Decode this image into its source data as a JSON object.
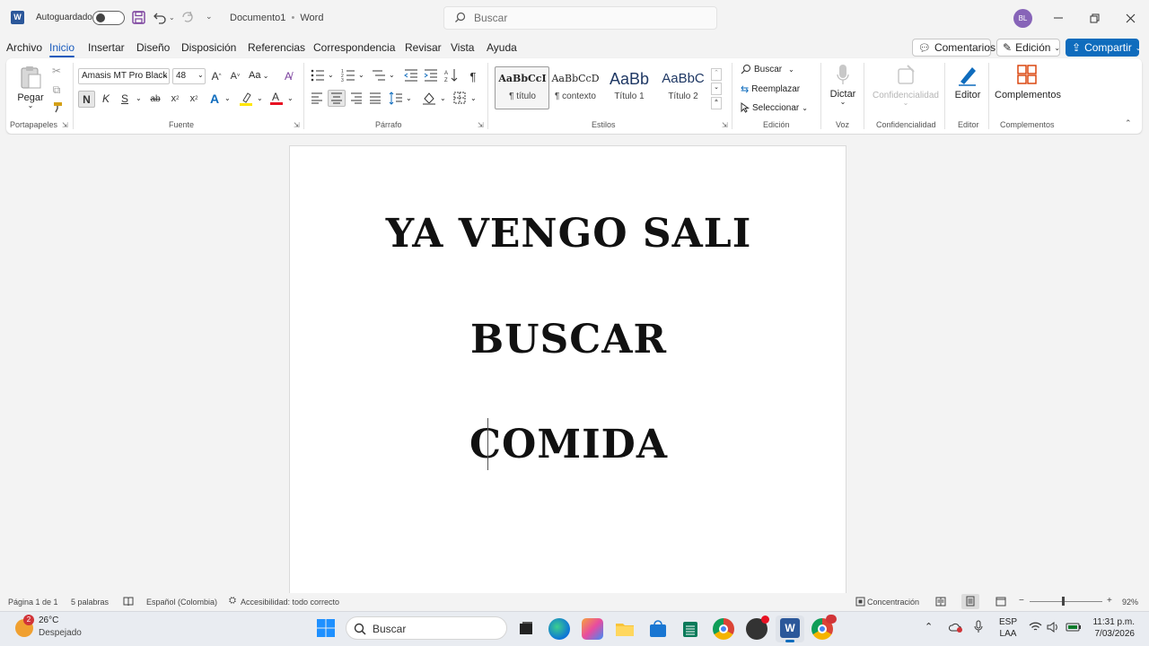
{
  "titlebar": {
    "autosave_label": "Autoguardado",
    "doc_name": "Documento1",
    "separator": "•",
    "app_name": "Word",
    "search_placeholder": "Buscar",
    "avatar_initials": "BL"
  },
  "menu": {
    "tabs": [
      "Archivo",
      "Inicio",
      "Insertar",
      "Diseño",
      "Disposición",
      "Referencias",
      "Correspondencia",
      "Revisar",
      "Vista",
      "Ayuda"
    ],
    "active_tab": "Inicio",
    "comments_label": "Comentarios",
    "editing_label": "Edición",
    "share_label": "Compartir"
  },
  "ribbon": {
    "clipboard": {
      "paste_label": "Pegar",
      "group_label": "Portapapeles"
    },
    "font": {
      "font_name": "Amasis MT Pro Black",
      "font_size": "48",
      "case_label": "Aa",
      "bold": "N",
      "italic": "K",
      "underline": "S",
      "strike": "ab",
      "group_label": "Fuente"
    },
    "paragraph": {
      "group_label": "Párrafo"
    },
    "styles": {
      "items": [
        {
          "preview": "AaBbCcI",
          "name": "¶ título"
        },
        {
          "preview": "AaBbCcD",
          "name": "¶ contexto"
        },
        {
          "preview": "AaBb",
          "name": "Título 1"
        },
        {
          "preview": "AaBbC",
          "name": "Título 2"
        }
      ],
      "group_label": "Estilos"
    },
    "editing": {
      "find": "Buscar",
      "replace": "Reemplazar",
      "select": "Seleccionar",
      "group_label": "Edición"
    },
    "voice": {
      "dictate": "Dictar",
      "group_label": "Voz"
    },
    "sensitivity": {
      "label": "Confidencialidad",
      "group_label": "Confidencialidad"
    },
    "editor": {
      "label": "Editor",
      "group_label": "Editor"
    },
    "addins": {
      "label": "Complementos",
      "group_label": "Complementos"
    }
  },
  "document": {
    "lines": [
      "YA VENGO SALI",
      "BUSCAR",
      "COMIDA"
    ]
  },
  "statusbar": {
    "page": "Página 1 de 1",
    "words": "5 palabras",
    "language": "Español (Colombia)",
    "accessibility": "Accesibilidad: todo correcto",
    "focus": "Concentración",
    "zoom": "92%"
  },
  "taskbar": {
    "weather_temp": "26°C",
    "weather_desc": "Despejado",
    "weather_badge": "2",
    "search_placeholder": "Buscar",
    "lang_line1": "ESP",
    "lang_line2": "LAA",
    "time": "11:31 p.m.",
    "date": "7/03/2026"
  },
  "colors": {
    "accent": "#185abd",
    "share_bg": "#0f6cbd",
    "word_blue": "#2b579a"
  }
}
